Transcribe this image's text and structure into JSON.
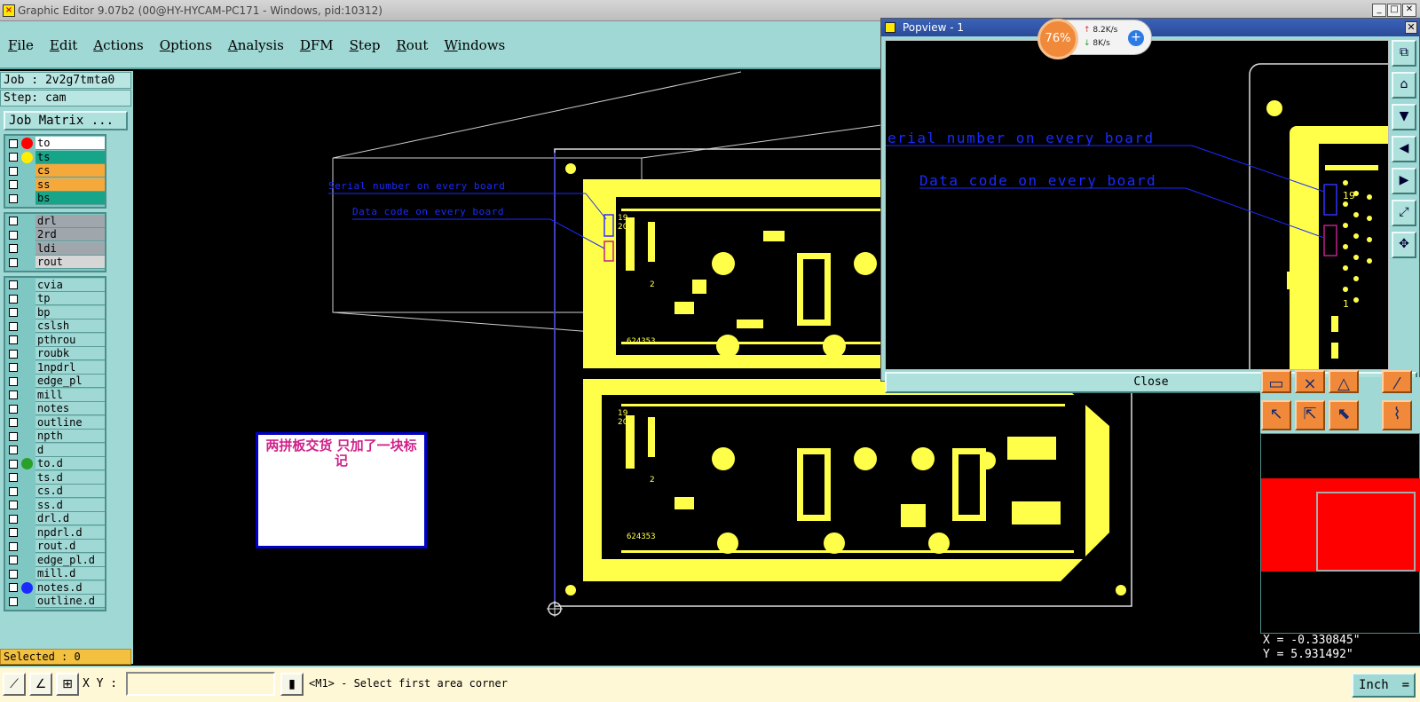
{
  "window": {
    "title": "Graphic Editor 9.07b2 (00@HY-HYCAM-PC171 - Windows, pid:10312)",
    "buttons": [
      "_",
      "□",
      "✕"
    ]
  },
  "menu": [
    "File",
    "Edit",
    "Actions",
    "Options",
    "Analysis",
    "DFM",
    "Step",
    "Rout",
    "Windows"
  ],
  "job_info": {
    "job": "Job : 2v2g7tmta0",
    "step": "Step: cam",
    "job_matrix": "Job Matrix ..."
  },
  "layer_groups": [
    [
      {
        "name": "to",
        "color": "#ffffff",
        "dot": "#ff0000"
      },
      {
        "name": "ts",
        "color": "#17a589",
        "dot": "#ffee00"
      },
      {
        "name": "cs",
        "color": "#f6a93b",
        "dot": ""
      },
      {
        "name": "ss",
        "color": "#f6a93b",
        "dot": ""
      },
      {
        "name": "bs",
        "color": "#17a589",
        "dot": ""
      }
    ],
    [
      {
        "name": "drl",
        "color": "#9fa7ad",
        "dot": ""
      },
      {
        "name": "2rd",
        "color": "#9fa7ad",
        "dot": ""
      },
      {
        "name": "ldi",
        "color": "#9fa7ad",
        "dot": ""
      },
      {
        "name": "rout",
        "color": "#d6d6d6",
        "dot": ""
      }
    ],
    [
      {
        "name": "cvia",
        "color": "#9fd8d4",
        "dot": ""
      },
      {
        "name": "tp",
        "color": "#9fd8d4",
        "dot": ""
      },
      {
        "name": "bp",
        "color": "#9fd8d4",
        "dot": ""
      },
      {
        "name": "cslsh",
        "color": "#9fd8d4",
        "dot": ""
      },
      {
        "name": "pthrou",
        "color": "#9fd8d4",
        "dot": ""
      },
      {
        "name": "roubk",
        "color": "#9fd8d4",
        "dot": ""
      },
      {
        "name": "1npdrl",
        "color": "#9fd8d4",
        "dot": ""
      },
      {
        "name": "edge_pl",
        "color": "#9fd8d4",
        "dot": ""
      },
      {
        "name": "mill",
        "color": "#9fd8d4",
        "dot": ""
      },
      {
        "name": "notes",
        "color": "#9fd8d4",
        "dot": ""
      },
      {
        "name": "outline",
        "color": "#9fd8d4",
        "dot": ""
      },
      {
        "name": "npth",
        "color": "#9fd8d4",
        "dot": ""
      },
      {
        "name": "d",
        "color": "#9fd8d4",
        "dot": ""
      },
      {
        "name": "to.d",
        "color": "#9fd8d4",
        "dot": "#2aa02a"
      },
      {
        "name": "ts.d",
        "color": "#9fd8d4",
        "dot": ""
      },
      {
        "name": "cs.d",
        "color": "#9fd8d4",
        "dot": ""
      },
      {
        "name": "ss.d",
        "color": "#9fd8d4",
        "dot": ""
      },
      {
        "name": "drl.d",
        "color": "#9fd8d4",
        "dot": ""
      },
      {
        "name": "npdrl.d",
        "color": "#9fd8d4",
        "dot": ""
      },
      {
        "name": "rout.d",
        "color": "#9fd8d4",
        "dot": ""
      },
      {
        "name": "edge_pl.d",
        "color": "#9fd8d4",
        "dot": ""
      },
      {
        "name": "mill.d",
        "color": "#9fd8d4",
        "dot": ""
      },
      {
        "name": "notes.d",
        "color": "#9fd8d4",
        "dot": "#1a2bff"
      },
      {
        "name": "outline.d",
        "color": "#9fd8d4",
        "dot": ""
      }
    ]
  ],
  "selected": "Selected : 0",
  "canvas": {
    "note_text": "两拼板交货  只加了一块标记",
    "serial_label": "Serial number on every board",
    "datacode_label": "Data code on every board",
    "board_numbers": [
      "624353",
      "624353"
    ],
    "ref_labels": [
      "19",
      "20",
      "2",
      "19",
      "20",
      "2"
    ]
  },
  "popview": {
    "title": "Popview - 1",
    "serial_label": "erial number on every board",
    "datacode_label": "Data code on every board",
    "ref_labels": [
      "19",
      "1"
    ],
    "close_label": "Close",
    "tool_icons": [
      "zoom-fit",
      "zoom-home",
      "zoom-down",
      "zoom-left",
      "zoom-right",
      "zoom-expand",
      "zoom-center"
    ]
  },
  "net_monitor": {
    "percent": "76%",
    "up_rate": "8.2K/s",
    "down_rate": "8K/s"
  },
  "coords": {
    "x": "X = -0.330845\"",
    "y": "Y = 5.931492\""
  },
  "bottom": {
    "xy_label": "X Y :",
    "xy_value": "",
    "status": "<M1> - Select first area corner",
    "units": "Inch"
  },
  "colors": {
    "accent": "#9fd8d4",
    "board": "#ffff4a",
    "annotation": "#1a2bff",
    "note_text": "#d0218a"
  }
}
